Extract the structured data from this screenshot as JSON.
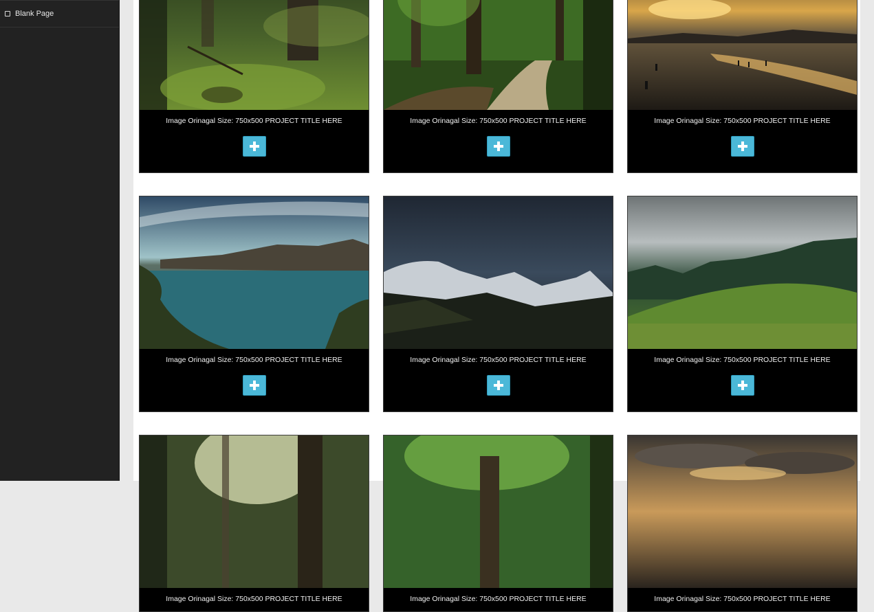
{
  "sidebar": {
    "items": [
      {
        "label": "Blank Page"
      }
    ]
  },
  "gallery": {
    "caption": "Image Orinagal Size: 750x500 PROJECT TITLE HERE",
    "button_icon": "plus-icon",
    "accent_color": "#4bb8d8",
    "items": [
      {
        "scene": "forest-moss"
      },
      {
        "scene": "forest-path"
      },
      {
        "scene": "beach-sunset"
      },
      {
        "scene": "mountain-lake"
      },
      {
        "scene": "snowy-mountains-night"
      },
      {
        "scene": "misty-green-hills"
      },
      {
        "scene": "forest-light"
      },
      {
        "scene": "green-tree"
      },
      {
        "scene": "cloudy-sky"
      }
    ]
  }
}
